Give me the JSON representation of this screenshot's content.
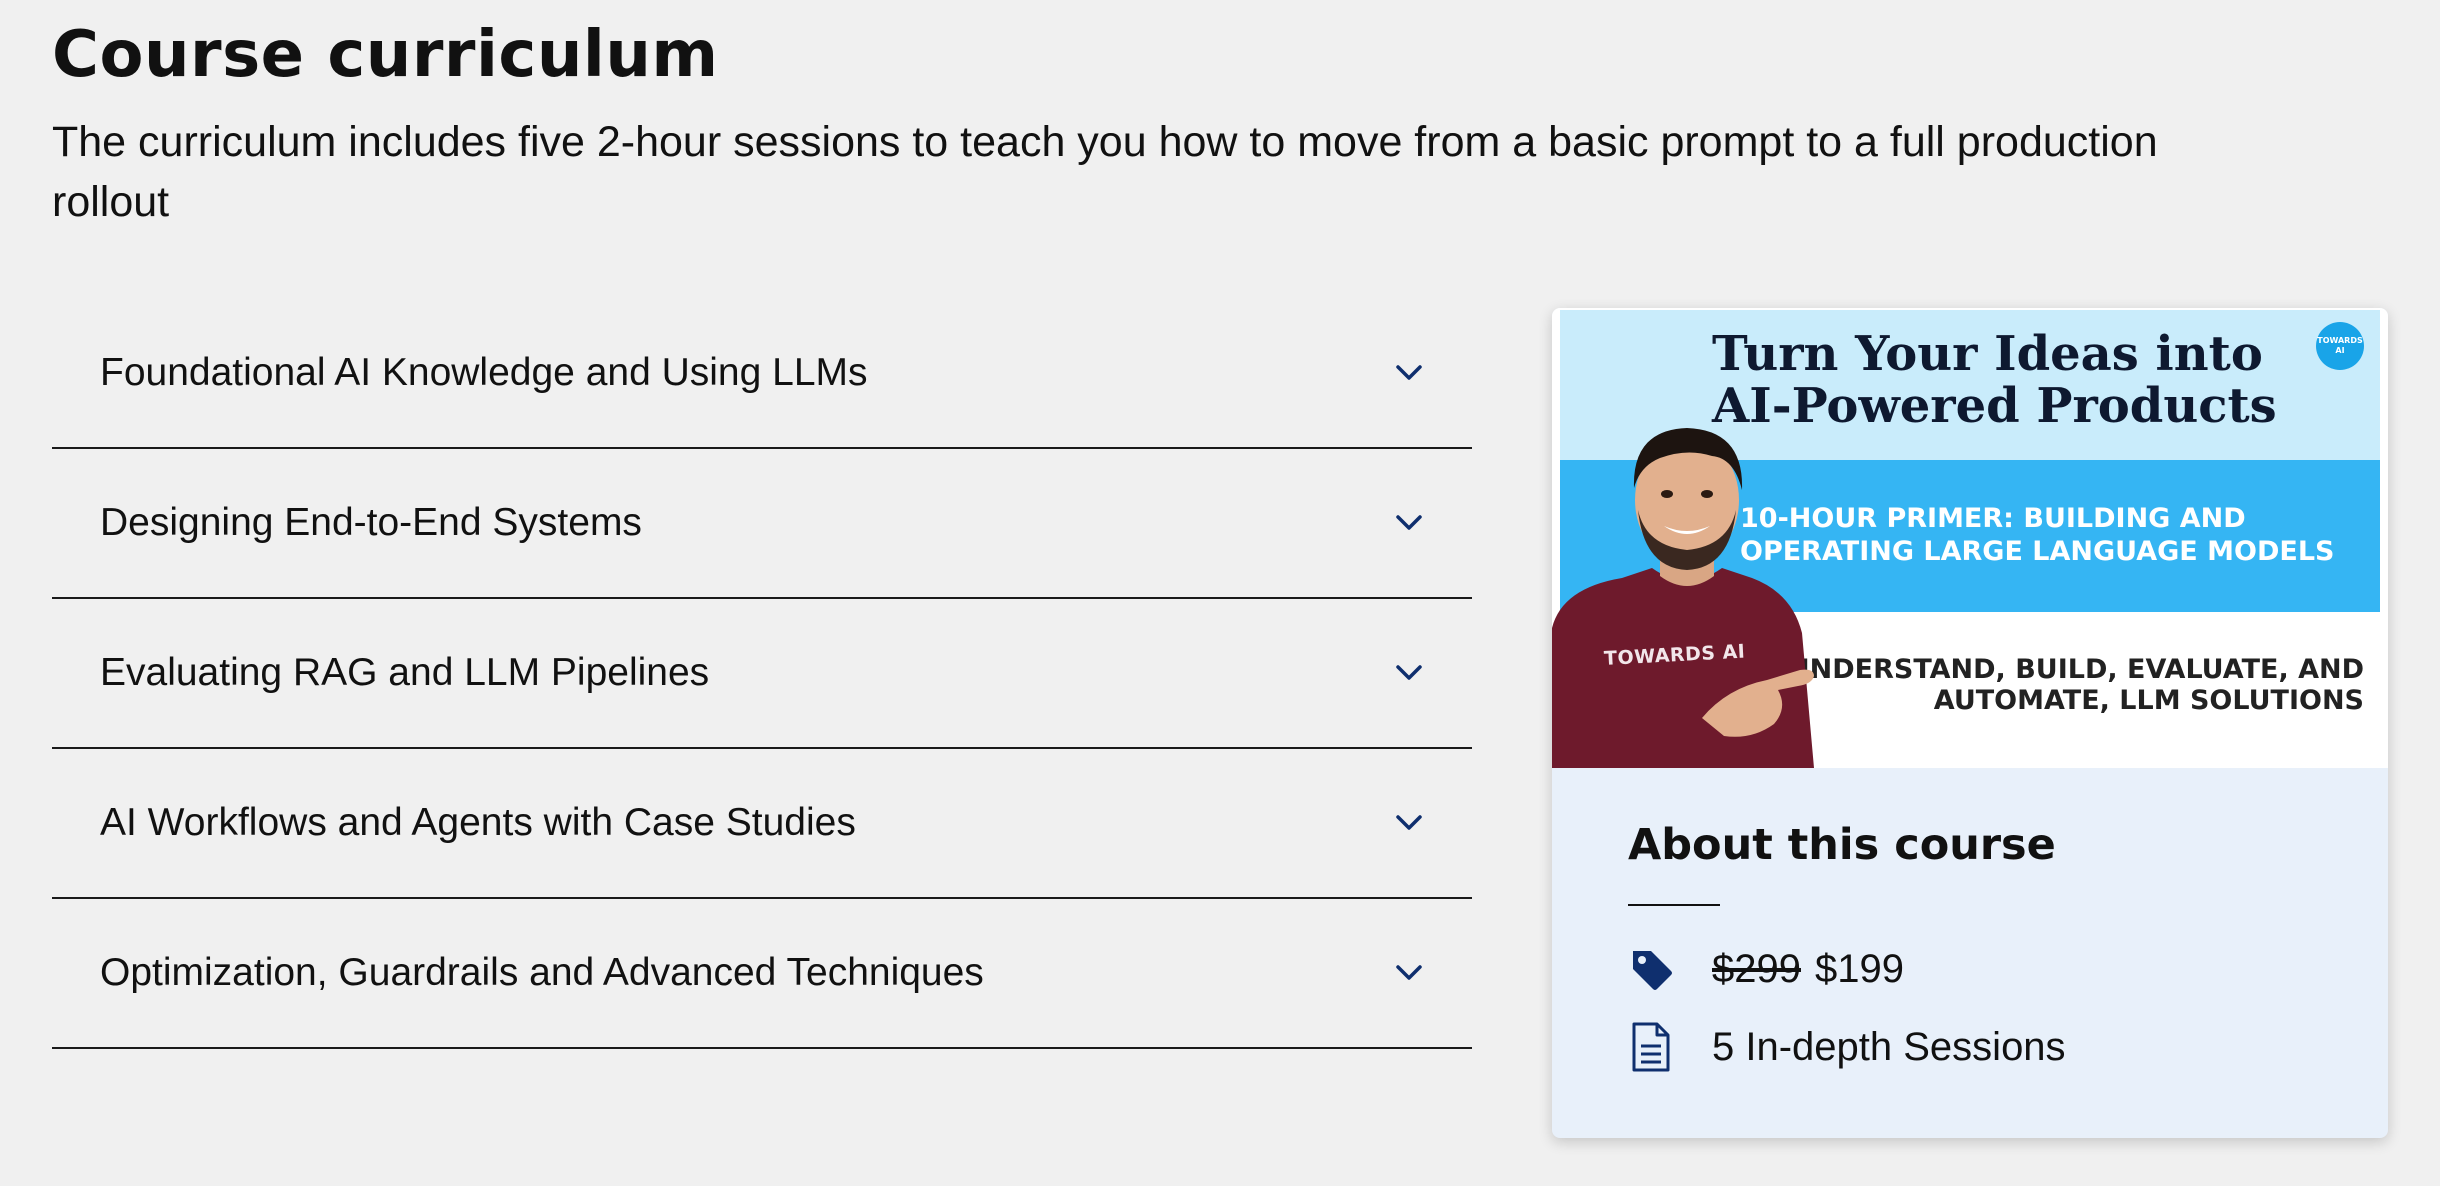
{
  "page": {
    "title": "Course curriculum",
    "subtitle": "The curriculum includes five 2-hour sessions to teach you how to move from a basic prompt to a full production rollout"
  },
  "accordion": {
    "items": [
      {
        "label": "Foundational AI Knowledge and Using LLMs",
        "icon": "chevron-down-icon"
      },
      {
        "label": "Designing End-to-End Systems",
        "icon": "chevron-down-icon"
      },
      {
        "label": "Evaluating RAG and LLM Pipelines",
        "icon": "chevron-down-icon"
      },
      {
        "label": "AI Workflows and Agents with Case Studies",
        "icon": "chevron-down-icon"
      },
      {
        "label": "Optimization, Guardrails and Advanced Techniques",
        "icon": "chevron-down-icon"
      }
    ]
  },
  "card": {
    "banner": {
      "headline": "Turn Your Ideas into AI-Powered Products",
      "primer": "10-HOUR PRIMER: BUILDING AND OPERATING LARGE LANGUAGE MODELS",
      "tagline": "UNDERSTAND, BUILD, EVALUATE, AND AUTOMATE, LLM SOLUTIONS",
      "logo_text": "TOWARDS AI",
      "shirt_text": "TOWARDS AI"
    },
    "about": {
      "title": "About this course",
      "old_price": "$299",
      "new_price": "$199",
      "sessions": "5 In-depth Sessions",
      "price_icon": "price-tag-icon",
      "sessions_icon": "document-icon"
    }
  },
  "colors": {
    "background": "#f0f0f0",
    "card_bg": "#e8f0fa",
    "icon_navy": "#0f2f6e",
    "banner_light_blue": "#c9ecfb",
    "banner_blue": "#35b5f3"
  }
}
